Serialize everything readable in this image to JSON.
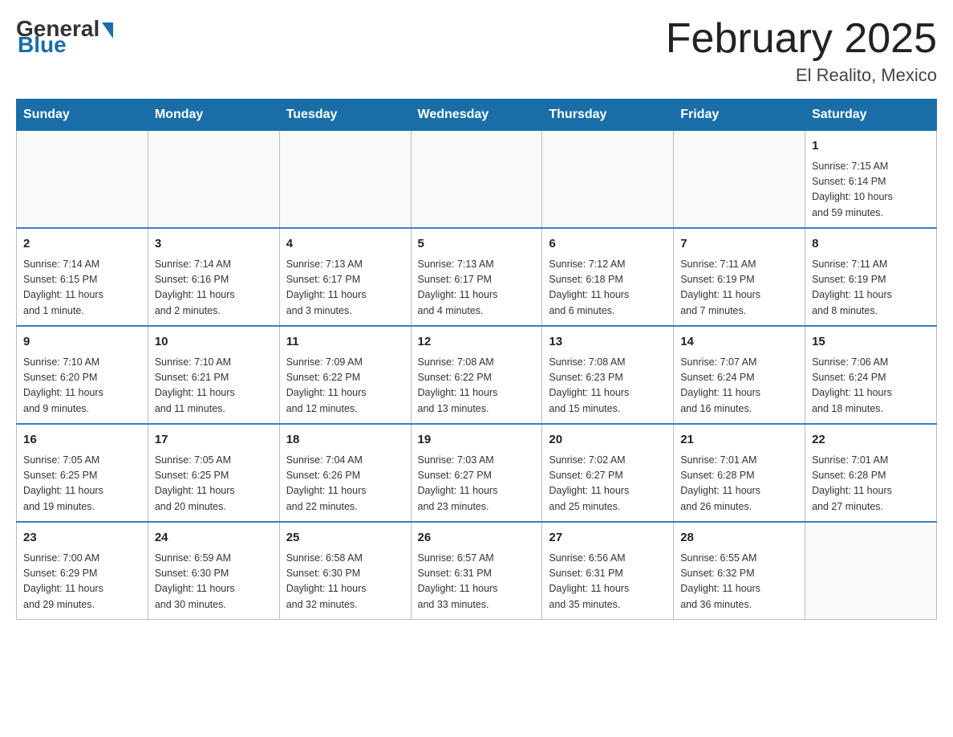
{
  "header": {
    "logo_general": "General",
    "logo_blue": "Blue",
    "month_title": "February 2025",
    "location": "El Realito, Mexico"
  },
  "weekdays": [
    "Sunday",
    "Monday",
    "Tuesday",
    "Wednesday",
    "Thursday",
    "Friday",
    "Saturday"
  ],
  "weeks": [
    [
      {
        "day": "",
        "info": ""
      },
      {
        "day": "",
        "info": ""
      },
      {
        "day": "",
        "info": ""
      },
      {
        "day": "",
        "info": ""
      },
      {
        "day": "",
        "info": ""
      },
      {
        "day": "",
        "info": ""
      },
      {
        "day": "1",
        "info": "Sunrise: 7:15 AM\nSunset: 6:14 PM\nDaylight: 10 hours\nand 59 minutes."
      }
    ],
    [
      {
        "day": "2",
        "info": "Sunrise: 7:14 AM\nSunset: 6:15 PM\nDaylight: 11 hours\nand 1 minute."
      },
      {
        "day": "3",
        "info": "Sunrise: 7:14 AM\nSunset: 6:16 PM\nDaylight: 11 hours\nand 2 minutes."
      },
      {
        "day": "4",
        "info": "Sunrise: 7:13 AM\nSunset: 6:17 PM\nDaylight: 11 hours\nand 3 minutes."
      },
      {
        "day": "5",
        "info": "Sunrise: 7:13 AM\nSunset: 6:17 PM\nDaylight: 11 hours\nand 4 minutes."
      },
      {
        "day": "6",
        "info": "Sunrise: 7:12 AM\nSunset: 6:18 PM\nDaylight: 11 hours\nand 6 minutes."
      },
      {
        "day": "7",
        "info": "Sunrise: 7:11 AM\nSunset: 6:19 PM\nDaylight: 11 hours\nand 7 minutes."
      },
      {
        "day": "8",
        "info": "Sunrise: 7:11 AM\nSunset: 6:19 PM\nDaylight: 11 hours\nand 8 minutes."
      }
    ],
    [
      {
        "day": "9",
        "info": "Sunrise: 7:10 AM\nSunset: 6:20 PM\nDaylight: 11 hours\nand 9 minutes."
      },
      {
        "day": "10",
        "info": "Sunrise: 7:10 AM\nSunset: 6:21 PM\nDaylight: 11 hours\nand 11 minutes."
      },
      {
        "day": "11",
        "info": "Sunrise: 7:09 AM\nSunset: 6:22 PM\nDaylight: 11 hours\nand 12 minutes."
      },
      {
        "day": "12",
        "info": "Sunrise: 7:08 AM\nSunset: 6:22 PM\nDaylight: 11 hours\nand 13 minutes."
      },
      {
        "day": "13",
        "info": "Sunrise: 7:08 AM\nSunset: 6:23 PM\nDaylight: 11 hours\nand 15 minutes."
      },
      {
        "day": "14",
        "info": "Sunrise: 7:07 AM\nSunset: 6:24 PM\nDaylight: 11 hours\nand 16 minutes."
      },
      {
        "day": "15",
        "info": "Sunrise: 7:06 AM\nSunset: 6:24 PM\nDaylight: 11 hours\nand 18 minutes."
      }
    ],
    [
      {
        "day": "16",
        "info": "Sunrise: 7:05 AM\nSunset: 6:25 PM\nDaylight: 11 hours\nand 19 minutes."
      },
      {
        "day": "17",
        "info": "Sunrise: 7:05 AM\nSunset: 6:25 PM\nDaylight: 11 hours\nand 20 minutes."
      },
      {
        "day": "18",
        "info": "Sunrise: 7:04 AM\nSunset: 6:26 PM\nDaylight: 11 hours\nand 22 minutes."
      },
      {
        "day": "19",
        "info": "Sunrise: 7:03 AM\nSunset: 6:27 PM\nDaylight: 11 hours\nand 23 minutes."
      },
      {
        "day": "20",
        "info": "Sunrise: 7:02 AM\nSunset: 6:27 PM\nDaylight: 11 hours\nand 25 minutes."
      },
      {
        "day": "21",
        "info": "Sunrise: 7:01 AM\nSunset: 6:28 PM\nDaylight: 11 hours\nand 26 minutes."
      },
      {
        "day": "22",
        "info": "Sunrise: 7:01 AM\nSunset: 6:28 PM\nDaylight: 11 hours\nand 27 minutes."
      }
    ],
    [
      {
        "day": "23",
        "info": "Sunrise: 7:00 AM\nSunset: 6:29 PM\nDaylight: 11 hours\nand 29 minutes."
      },
      {
        "day": "24",
        "info": "Sunrise: 6:59 AM\nSunset: 6:30 PM\nDaylight: 11 hours\nand 30 minutes."
      },
      {
        "day": "25",
        "info": "Sunrise: 6:58 AM\nSunset: 6:30 PM\nDaylight: 11 hours\nand 32 minutes."
      },
      {
        "day": "26",
        "info": "Sunrise: 6:57 AM\nSunset: 6:31 PM\nDaylight: 11 hours\nand 33 minutes."
      },
      {
        "day": "27",
        "info": "Sunrise: 6:56 AM\nSunset: 6:31 PM\nDaylight: 11 hours\nand 35 minutes."
      },
      {
        "day": "28",
        "info": "Sunrise: 6:55 AM\nSunset: 6:32 PM\nDaylight: 11 hours\nand 36 minutes."
      },
      {
        "day": "",
        "info": ""
      }
    ]
  ]
}
